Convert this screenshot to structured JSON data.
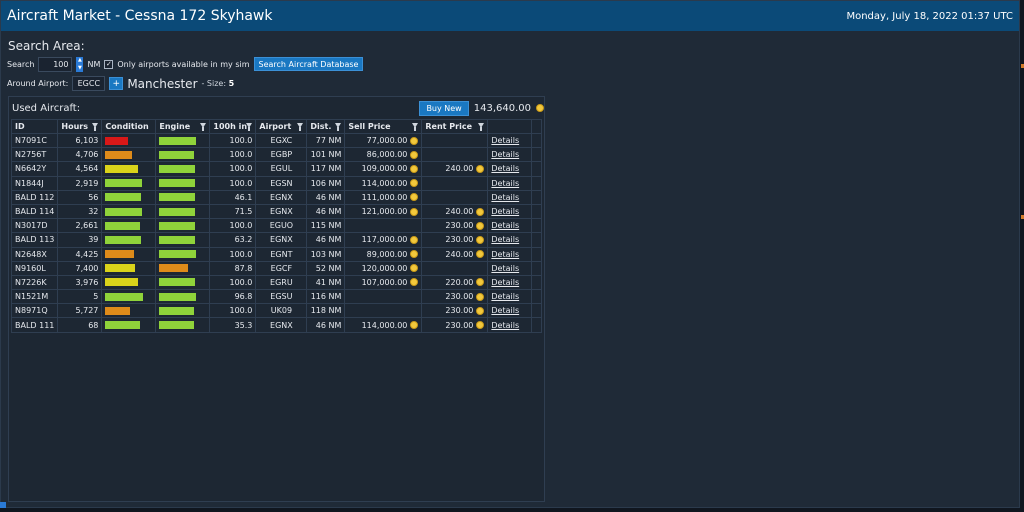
{
  "window": {
    "title": "Aircraft Market - Cessna 172 Skyhawk",
    "datetime": "Monday, July 18, 2022 01:37 UTC"
  },
  "search": {
    "title": "Search Area:",
    "search_label": "Search",
    "distance_value": "100",
    "distance_unit": "NM",
    "only_available_label": "Only airports available in my sim",
    "only_available_checked": true,
    "search_button": "Search Aircraft Database",
    "around_label": "Around Airport:",
    "airport_value": "EGCC",
    "plus_label": "+",
    "city": "Manchester",
    "size_label": "- Size:",
    "size_value": "5"
  },
  "used": {
    "title": "Used Aircraft:",
    "buy_new": "Buy New",
    "price": "143,640.00"
  },
  "colors": {
    "bar_green": "#8fd33a",
    "bar_yellow": "#d9d31a",
    "bar_orange": "#de8b1a",
    "bar_red": "#d81818"
  },
  "columns": [
    "ID",
    "Hours",
    "Condition",
    "Engine",
    "100h in",
    "Airport",
    "Dist.",
    "Sell Price",
    "Rent Price"
  ],
  "rows": [
    {
      "id": "N7091C",
      "hours": "6,103",
      "cond": 0.6,
      "cond_color": "#d81818",
      "eng": 0.97,
      "eng_color": "#8fd33a",
      "h100": "100.0",
      "airport": "EGXC",
      "dist": "77 NM",
      "sell": "77,000.00",
      "rent": "",
      "details": "Details"
    },
    {
      "id": "N2756T",
      "hours": "4,706",
      "cond": 0.7,
      "cond_color": "#de8b1a",
      "eng": 0.93,
      "eng_color": "#8fd33a",
      "h100": "100.0",
      "airport": "EGBP",
      "dist": "101 NM",
      "sell": "86,000.00",
      "rent": "",
      "details": "Details"
    },
    {
      "id": "N6642Y",
      "hours": "4,564",
      "cond": 0.88,
      "cond_color": "#d9d31a",
      "eng": 0.95,
      "eng_color": "#8fd33a",
      "h100": "100.0",
      "airport": "EGUL",
      "dist": "117 NM",
      "sell": "109,000.00",
      "rent": "240.00",
      "details": "Details"
    },
    {
      "id": "N1844J",
      "hours": "2,919",
      "cond": 0.98,
      "cond_color": "#8fd33a",
      "eng": 0.95,
      "eng_color": "#8fd33a",
      "h100": "100.0",
      "airport": "EGSN",
      "dist": "106 NM",
      "sell": "114,000.00",
      "rent": "",
      "details": "Details"
    },
    {
      "id": "BALD 112",
      "hours": "56",
      "cond": 0.95,
      "cond_color": "#8fd33a",
      "eng": 0.95,
      "eng_color": "#8fd33a",
      "h100": "46.1",
      "airport": "EGNX",
      "dist": "46 NM",
      "sell": "111,000.00",
      "rent": "",
      "details": "Details"
    },
    {
      "id": "BALD 114",
      "hours": "32",
      "cond": 0.98,
      "cond_color": "#8fd33a",
      "eng": 0.95,
      "eng_color": "#8fd33a",
      "h100": "71.5",
      "airport": "EGNX",
      "dist": "46 NM",
      "sell": "121,000.00",
      "rent": "240.00",
      "details": "Details"
    },
    {
      "id": "N3017D",
      "hours": "2,661",
      "cond": 0.93,
      "cond_color": "#8fd33a",
      "eng": 0.95,
      "eng_color": "#8fd33a",
      "h100": "100.0",
      "airport": "EGUO",
      "dist": "115 NM",
      "sell": "",
      "rent": "230.00",
      "details": "Details"
    },
    {
      "id": "BALD 113",
      "hours": "39",
      "cond": 0.95,
      "cond_color": "#8fd33a",
      "eng": 0.95,
      "eng_color": "#8fd33a",
      "h100": "63.2",
      "airport": "EGNX",
      "dist": "46 NM",
      "sell": "117,000.00",
      "rent": "230.00",
      "details": "Details"
    },
    {
      "id": "N2648X",
      "hours": "4,425",
      "cond": 0.75,
      "cond_color": "#de8b1a",
      "eng": 0.97,
      "eng_color": "#8fd33a",
      "h100": "100.0",
      "airport": "EGNT",
      "dist": "103 NM",
      "sell": "89,000.00",
      "rent": "240.00",
      "details": "Details"
    },
    {
      "id": "N9160L",
      "hours": "7,400",
      "cond": 0.8,
      "cond_color": "#d9d31a",
      "eng": 0.75,
      "eng_color": "#de8b1a",
      "h100": "87.8",
      "airport": "EGCF",
      "dist": "52 NM",
      "sell": "120,000.00",
      "rent": "",
      "details": "Details"
    },
    {
      "id": "N7226K",
      "hours": "3,976",
      "cond": 0.88,
      "cond_color": "#d9d31a",
      "eng": 0.95,
      "eng_color": "#8fd33a",
      "h100": "100.0",
      "airport": "EGRU",
      "dist": "41 NM",
      "sell": "107,000.00",
      "rent": "220.00",
      "details": "Details"
    },
    {
      "id": "N1521M",
      "hours": "5",
      "cond": 1.0,
      "cond_color": "#8fd33a",
      "eng": 0.97,
      "eng_color": "#8fd33a",
      "h100": "96.8",
      "airport": "EGSU",
      "dist": "116 NM",
      "sell": "",
      "rent": "230.00",
      "details": "Details"
    },
    {
      "id": "N8971Q",
      "hours": "5,727",
      "cond": 0.65,
      "cond_color": "#de8b1a",
      "eng": 0.93,
      "eng_color": "#8fd33a",
      "h100": "100.0",
      "airport": "UK09",
      "dist": "118 NM",
      "sell": "",
      "rent": "230.00",
      "details": "Details"
    },
    {
      "id": "BALD 111",
      "hours": "68",
      "cond": 0.93,
      "cond_color": "#8fd33a",
      "eng": 0.93,
      "eng_color": "#8fd33a",
      "h100": "35.3",
      "airport": "EGNX",
      "dist": "46 NM",
      "sell": "114,000.00",
      "rent": "230.00",
      "details": "Details"
    }
  ]
}
